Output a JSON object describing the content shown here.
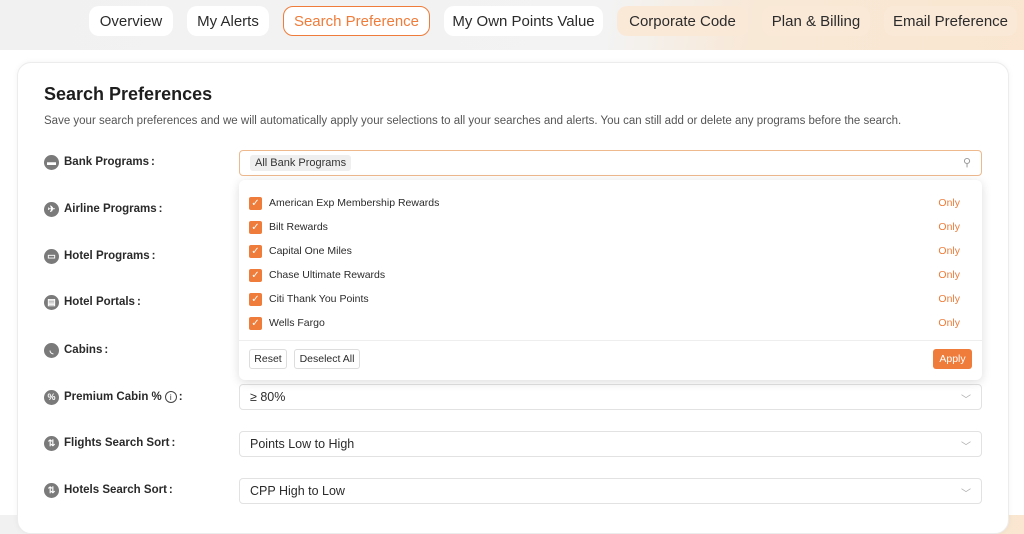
{
  "tabs": [
    {
      "label": "Overview"
    },
    {
      "label": "My Alerts"
    },
    {
      "label": "Search Preference"
    },
    {
      "label": "My Own Points Value"
    },
    {
      "label": "Corporate Code"
    },
    {
      "label": "Plan & Billing"
    },
    {
      "label": "Email Preference"
    }
  ],
  "active_tab": "Search Preference",
  "accent_color": "#ef7c3a",
  "page": {
    "title": "Search Preferences",
    "description": "Save your search preferences and we will automatically apply your selections to all your searches and alerts. You can still add or delete any programs before the search."
  },
  "rows": {
    "bank": {
      "label": "Bank Programs",
      "icon": "bank-card-icon"
    },
    "airline": {
      "label": "Airline Programs",
      "icon": "airplane-icon"
    },
    "hotel": {
      "label": "Hotel Programs",
      "icon": "bed-icon"
    },
    "portals": {
      "label": "Hotel Portals",
      "icon": "hotel-building-icon"
    },
    "cabins": {
      "label": "Cabins",
      "icon": "seat-icon"
    },
    "premium": {
      "label": "Premium Cabin %",
      "icon": "percent-seat-icon"
    },
    "flight_sort": {
      "label": "Flights Search Sort",
      "icon": "flight-sort-icon"
    },
    "hotel_sort": {
      "label": "Hotels Search Sort",
      "icon": "hotel-sort-icon"
    }
  },
  "colon": ":",
  "bank_select": {
    "chip": "All Bank Programs"
  },
  "dropdown": {
    "options": [
      {
        "label": "American Exp Membership Rewards",
        "checked": true
      },
      {
        "label": "Bilt Rewards",
        "checked": true
      },
      {
        "label": "Capital One Miles",
        "checked": true
      },
      {
        "label": "Chase Ultimate Rewards",
        "checked": true
      },
      {
        "label": "Citi Thank You Points",
        "checked": true
      },
      {
        "label": "Wells Fargo",
        "checked": true
      }
    ],
    "only_label": "Only",
    "reset_label": "Reset",
    "deselect_label": "Deselect All",
    "apply_label": "Apply"
  },
  "selects": {
    "premium_value": "≥ 80%",
    "flight_sort_value": "Points Low to High",
    "hotel_sort_value": "CPP High to Low"
  }
}
